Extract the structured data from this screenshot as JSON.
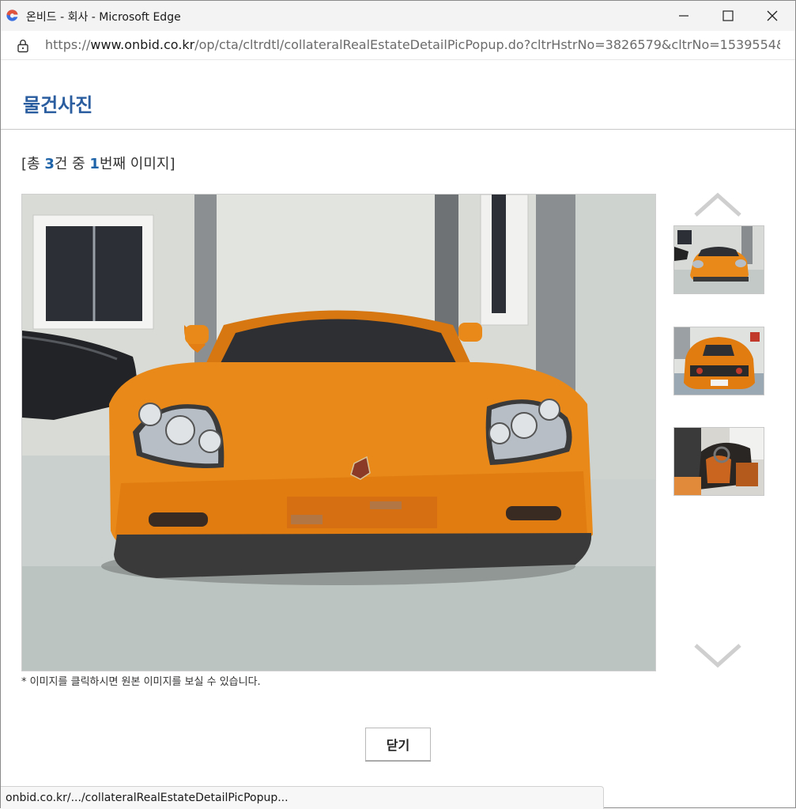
{
  "window": {
    "title": "온비드 - 회사 - Microsoft Edge",
    "url_scheme": "https://",
    "url_domain": "www.onbid.co.kr",
    "url_path": "/op/cta/cltrdtl/collateralRealEstateDetailPicPopup.do?cltrHstrNo=3826579&cltrNo=1539554&..."
  },
  "page": {
    "title": "물건사진",
    "counter": {
      "prefix": "[총 ",
      "total": "3",
      "middle": "건 중 ",
      "current": "1",
      "suffix": "번째 이미지]"
    },
    "note": "* 이미지를 클릭하시면 원본 이미지를 보실 수 있습니다.",
    "close_label": "닫기"
  },
  "thumbnails": [
    {
      "icon": "car-front-thumbnail-icon"
    },
    {
      "icon": "car-rear-thumbnail-icon"
    },
    {
      "icon": "car-interior-thumbnail-icon"
    }
  ],
  "status": {
    "link_preview": "onbid.co.kr/.../collateralRealEstateDetailPicPopup..."
  },
  "colors": {
    "title_blue": "#2a5d9f",
    "count_blue": "#1f63a8",
    "car_orange": "#e8891a"
  }
}
